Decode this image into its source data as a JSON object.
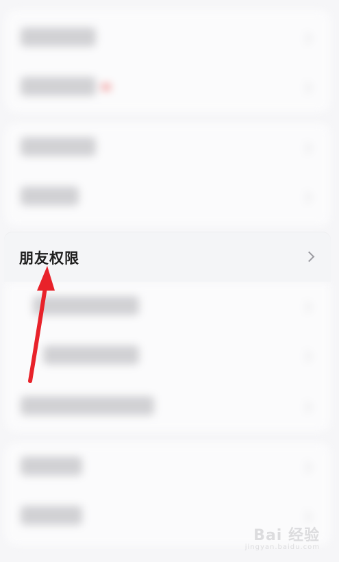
{
  "focus_item": {
    "label": "朋友权限",
    "icon": "chevron-right-icon"
  },
  "annotation": {
    "arrow_color": "#e8222a"
  },
  "watermark": {
    "brand": "Bai 经验",
    "url": "jingyan.baidu.com"
  }
}
